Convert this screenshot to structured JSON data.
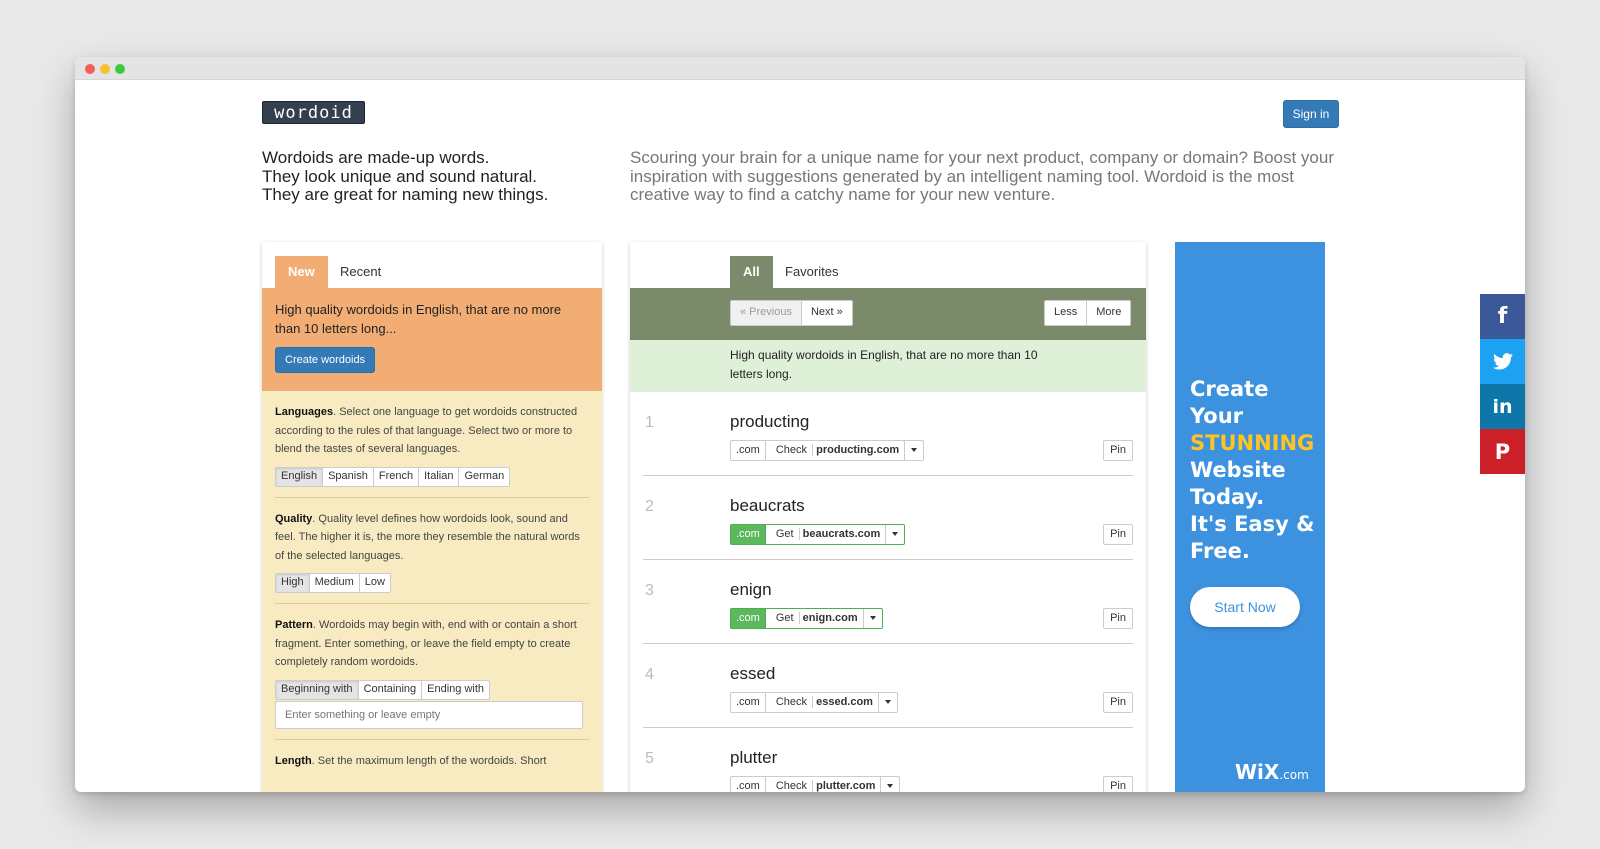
{
  "header": {
    "logo_text": "wordoid",
    "signin_label": "Sign in"
  },
  "tagline": {
    "line1": "Wordoids are made-up words.",
    "line2": "They look unique and sound natural.",
    "line3": "They are great for naming new things."
  },
  "intro": "Scouring your brain for a unique name for your next product, company or domain? Boost your inspiration with suggestions generated by an intelligent naming tool. Wordoid is the most creative way to find a catchy name for your new venture.",
  "left_panel": {
    "tab_new": "New",
    "tab_recent": "Recent",
    "summary": "High quality wordoids in English, that are no more than 10 letters long...",
    "create_label": "Create wordoids",
    "languages": {
      "title": "Languages",
      "text": ". Select one language to get wordoids constructed according to the rules of that language. Select two or more to blend the tastes of several languages.",
      "options": [
        "English",
        "Spanish",
        "French",
        "Italian",
        "German"
      ]
    },
    "quality": {
      "title": "Quality",
      "text": ". Quality level defines how wordoids look, sound and feel. The higher it is, the more they resemble the natural words of the selected languages.",
      "options": [
        "High",
        "Medium",
        "Low"
      ]
    },
    "pattern": {
      "title": "Pattern",
      "text": ". Wordoids may begin with, end with or contain a short fragment. Enter something, or leave the field empty to create completely random wordoids.",
      "options": [
        "Beginning with",
        "Containing",
        "Ending with"
      ],
      "placeholder": "Enter something or leave empty"
    },
    "length": {
      "title": "Length",
      "text": ". Set the maximum length of the wordoids. Short"
    }
  },
  "center_panel": {
    "tab_all": "All",
    "tab_favorites": "Favorites",
    "prev_label": "« Previous",
    "next_label": "Next »",
    "less_label": "Less",
    "more_label": "More",
    "info": "High quality wordoids in English, that are no more than 10 letters long.",
    "pin_label": "Pin",
    "words": [
      {
        "num": "1",
        "word": "producting",
        "tld": ".com",
        "action": "Check",
        "domain": "producting.com",
        "available": false
      },
      {
        "num": "2",
        "word": "beaucrats",
        "tld": ".com",
        "action": "Get",
        "domain": "beaucrats.com",
        "available": true
      },
      {
        "num": "3",
        "word": "enign",
        "tld": ".com",
        "action": "Get",
        "domain": "enign.com",
        "available": true
      },
      {
        "num": "4",
        "word": "essed",
        "tld": ".com",
        "action": "Check",
        "domain": "essed.com",
        "available": false
      },
      {
        "num": "5",
        "word": "plutter",
        "tld": ".com",
        "action": "Check",
        "domain": "plutter.com",
        "available": false
      }
    ]
  },
  "ad": {
    "line1": "Create",
    "line2": "Your",
    "highlight": "STUNNING",
    "line3": "Website",
    "line4": "Today.",
    "line5": "It's Easy &",
    "line6": "Free.",
    "button": "Start Now",
    "brand": "WiX",
    "brand_suffix": ".com",
    "highlight_color": "#ffc41f",
    "bg_color": "#3d92e0"
  },
  "social": {
    "facebook_glyph": "f",
    "twitter_glyph": "t",
    "linkedin_glyph": "in",
    "pinterest_glyph": "P"
  },
  "colors": {
    "orange_accent": "#f2ad74",
    "green_accent": "#7a8a6a",
    "primary": "#337ab7",
    "available_green": "#5cb85c"
  }
}
